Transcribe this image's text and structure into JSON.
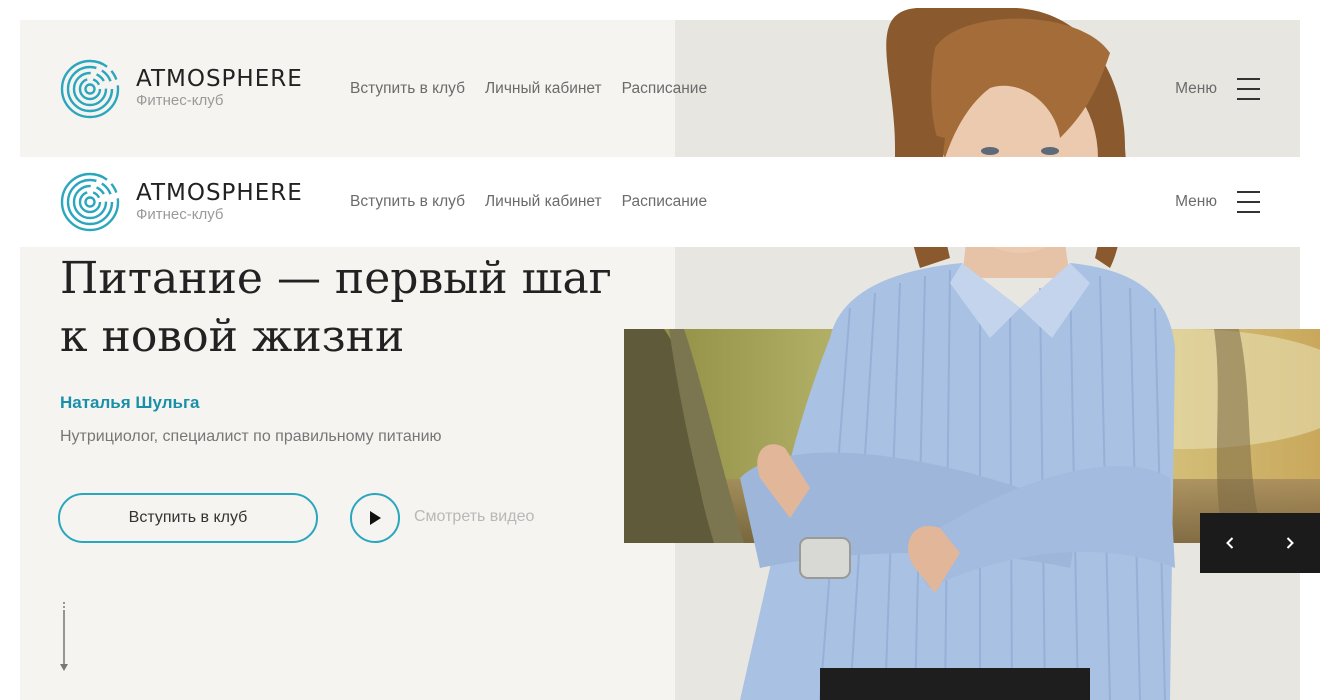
{
  "brand": {
    "name": "ATMOSPHERE",
    "subtitle": "Фитнес-клуб",
    "accent_color": "#2aa6bd"
  },
  "nav": {
    "items": [
      {
        "label": "Вступить в клуб"
      },
      {
        "label": "Личный кабинет"
      },
      {
        "label": "Расписание"
      }
    ],
    "menu_label": "Меню"
  },
  "hero": {
    "title_line1": "Питание — первый шаг",
    "title_line2": "к новой жизни",
    "author_name": "Наталья Шульга",
    "author_role": "Нутрициолог, специалист по правильному питанию",
    "join_label": "Вступить в клуб",
    "video_label": "Смотреть видео"
  },
  "icons": {
    "logo": "concentric-circles-logo",
    "menu": "hamburger-icon",
    "play": "play-icon",
    "scroll": "arrow-down-icon",
    "prev": "chevron-left-icon",
    "next": "chevron-right-icon"
  }
}
